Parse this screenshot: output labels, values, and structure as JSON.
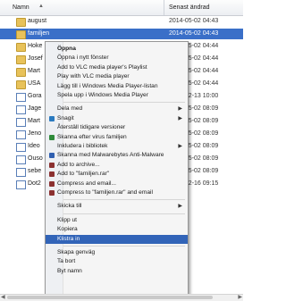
{
  "columns": {
    "name": "Namn",
    "date": "Senast ändrad"
  },
  "files": [
    {
      "name": "august",
      "date": "2014-05-02 04:43",
      "type": "folder"
    },
    {
      "name": "familjen",
      "date": "2014-05-02 04:43",
      "type": "folder",
      "selected": true
    },
    {
      "name": "Hoke",
      "date": "2014-05-02 04:44",
      "type": "folder"
    },
    {
      "name": "Josef",
      "date": "2014-05-02 04:44",
      "type": "folder"
    },
    {
      "name": "Mart",
      "date": "2014-05-02 04:44",
      "type": "folder"
    },
    {
      "name": "USA",
      "date": "2014-05-02 04:44",
      "type": "folder"
    },
    {
      "name": "Gora",
      "date": "2014-02-13 10:00",
      "type": "file"
    },
    {
      "name": "Jage",
      "date": "2014-05-02 08:09",
      "type": "file"
    },
    {
      "name": "Mart",
      "date": "2014-05-02 08:09",
      "type": "file"
    },
    {
      "name": "Jeno",
      "date": "2014-05-02 08:09",
      "type": "file"
    },
    {
      "name": "Ideo",
      "date": "2014-05-02 08:09",
      "type": "file"
    },
    {
      "name": "Ouso",
      "date": "2014-05-02 08:09",
      "type": "file"
    },
    {
      "name": "sebe",
      "date": "2014-05-02 08:09",
      "type": "file"
    },
    {
      "name": "Dot2",
      "date": "2014-02-16 09:15",
      "type": "file"
    }
  ],
  "menu": {
    "items": [
      {
        "label": "Öppna",
        "bold": true
      },
      {
        "label": "Öppna i nytt fönster"
      },
      {
        "label": "Add to VLC media player's Playlist"
      },
      {
        "label": "Play with VLC media player"
      },
      {
        "label": "Lägg till i Windows Media Player-listan"
      },
      {
        "label": "Spela upp i Windows Media Player"
      },
      {
        "sep": true
      },
      {
        "label": "Dela med",
        "submenu": true
      },
      {
        "label": "Snagit",
        "submenu": true,
        "icon": "#2a7ac0"
      },
      {
        "label": "Återställ tidigare versioner"
      },
      {
        "label": "Skanna efter virus familjen",
        "icon": "#2e8b3a"
      },
      {
        "label": "Inkludera i bibliotek",
        "submenu": true
      },
      {
        "label": "Skanna med Malwarebytes Anti-Malware",
        "icon": "#2f5fb0"
      },
      {
        "label": "Add to archive...",
        "icon": "#8b3030"
      },
      {
        "label": "Add to \"familjen.rar\"",
        "icon": "#8b3030"
      },
      {
        "label": "Compress and email...",
        "icon": "#8b3030"
      },
      {
        "label": "Compress to \"familjen.rar\" and email",
        "icon": "#8b3030"
      },
      {
        "sep": true
      },
      {
        "label": "Skicka till",
        "submenu": true
      },
      {
        "sep": true
      },
      {
        "label": "Klipp ut"
      },
      {
        "label": "Kopiera"
      },
      {
        "label": "Klistra in",
        "highlighted": true
      },
      {
        "sep": true
      },
      {
        "label": "Skapa genväg"
      },
      {
        "label": "Ta bort"
      },
      {
        "label": "Byt namn"
      }
    ]
  },
  "colors": {
    "selection": "#3a6fc8",
    "highlight": "#3264b8",
    "folder": "#e8c25a"
  }
}
